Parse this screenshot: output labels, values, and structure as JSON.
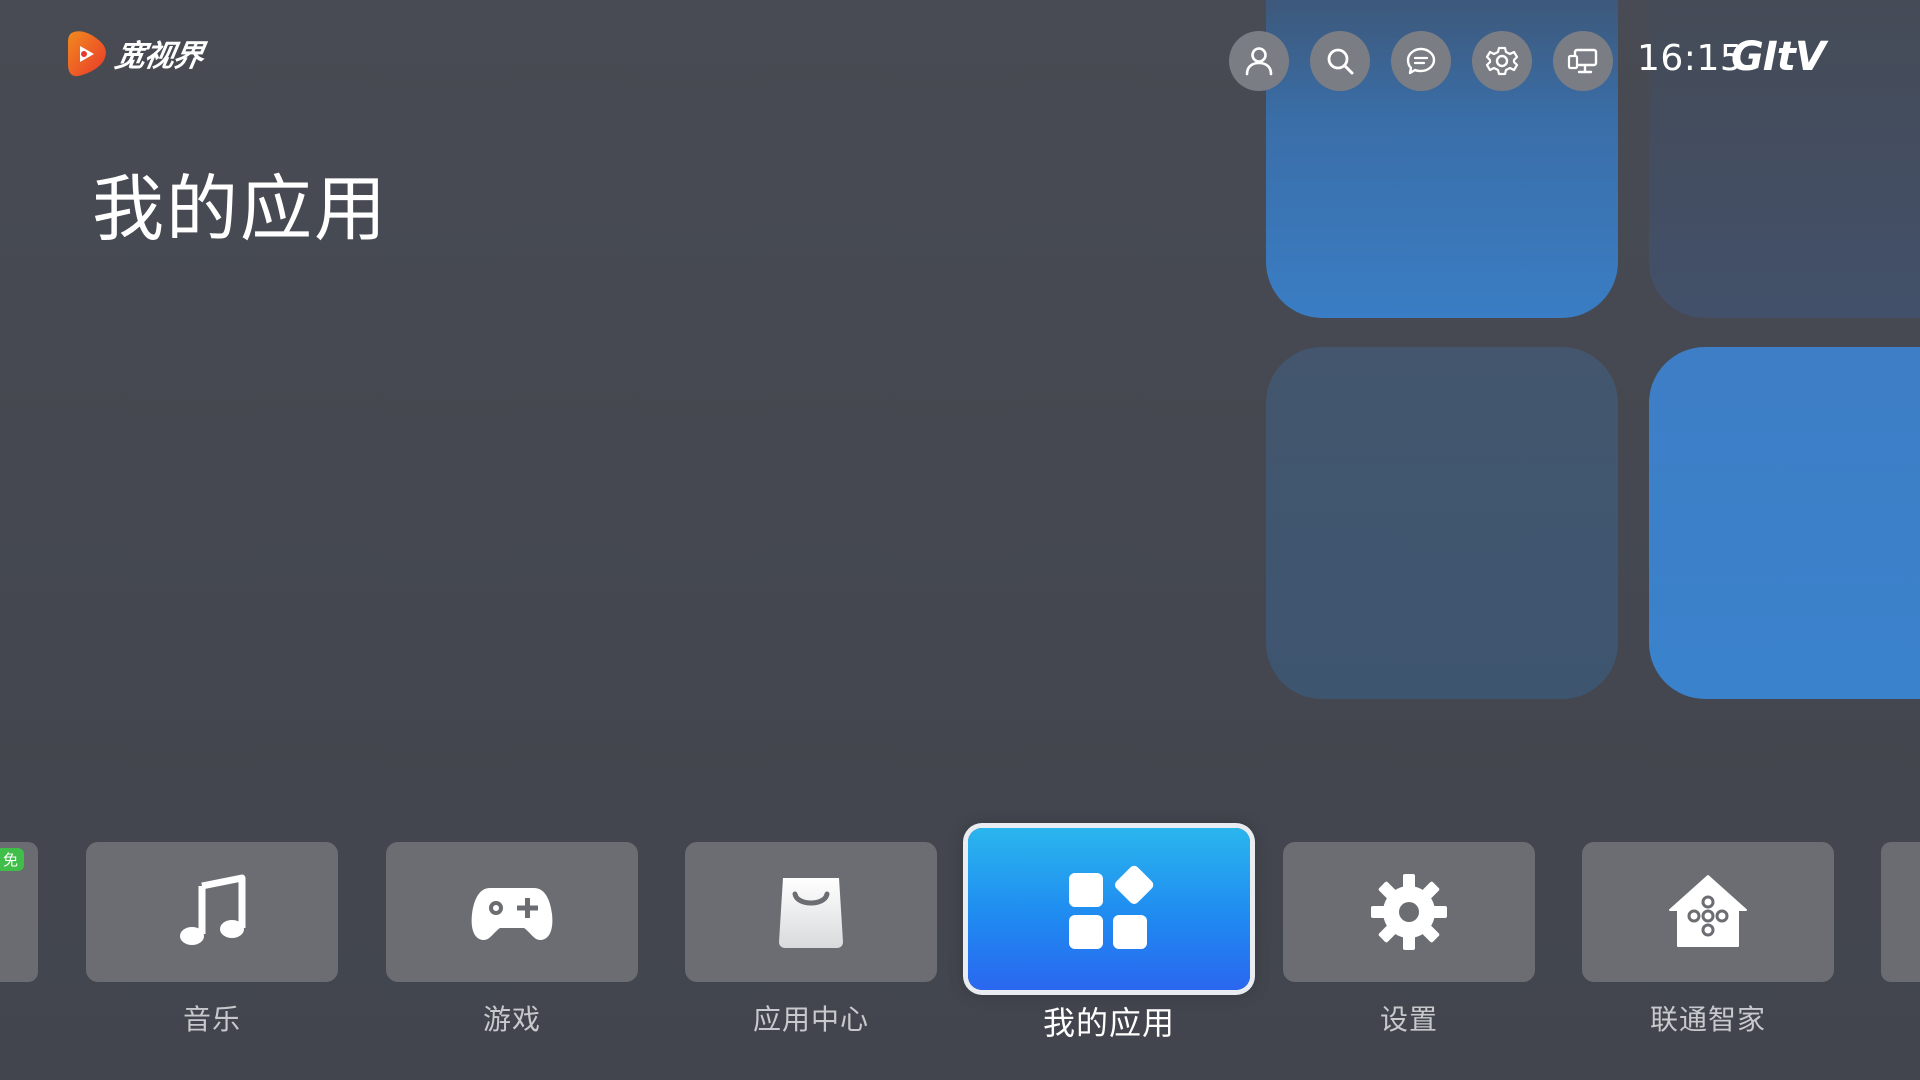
{
  "logo": {
    "text": "宽视界",
    "colors": {
      "mark": "#f0552b",
      "mark_alt": "#f28a1e"
    }
  },
  "topbar": {
    "icons": [
      {
        "name": "user-icon"
      },
      {
        "name": "search-icon"
      },
      {
        "name": "message-icon"
      },
      {
        "name": "settings-icon"
      },
      {
        "name": "screen-icon"
      }
    ],
    "time": "16:15",
    "brand": "GItV"
  },
  "page": {
    "title": "我的应用"
  },
  "dock": {
    "left_badge": "免",
    "items": [
      {
        "label": "音乐",
        "icon": "music-note-icon",
        "selected": false
      },
      {
        "label": "游戏",
        "icon": "gamepad-icon",
        "selected": false
      },
      {
        "label": "应用中心",
        "icon": "shopping-bag-icon",
        "selected": false
      },
      {
        "label": "我的应用",
        "icon": "app-grid-icon",
        "selected": true
      },
      {
        "label": "设置",
        "icon": "gear-icon",
        "selected": false
      },
      {
        "label": "联通智家",
        "icon": "smart-home-icon",
        "selected": false
      }
    ]
  },
  "colors": {
    "background": "#454850",
    "tile": "#6b6d72",
    "selected_start": "#2ab6ee",
    "selected_end": "#2a67f0",
    "deco_blue": "#3a7dc4",
    "badge_green": "#3fbf49"
  }
}
